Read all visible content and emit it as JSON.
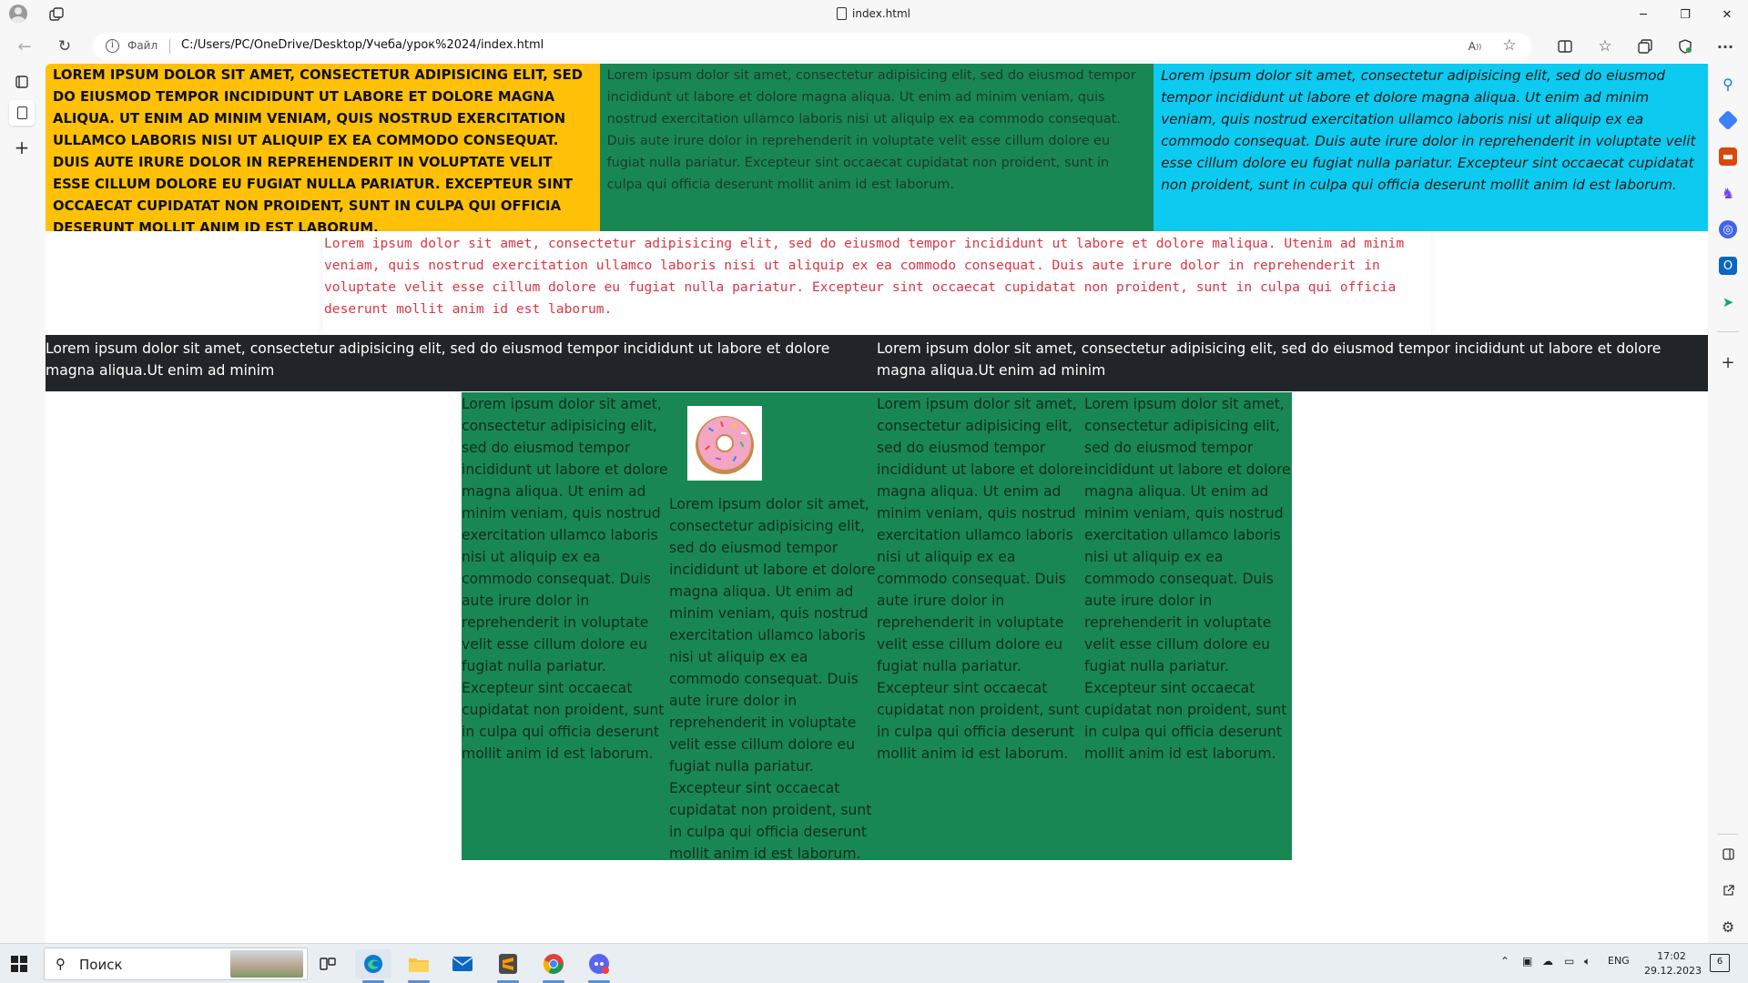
{
  "window": {
    "tab_title": "index.html",
    "minimize": "─",
    "restore": "❐",
    "close": "✕"
  },
  "address_bar": {
    "scheme_label": "Файл",
    "url": "C:/Users/PC/OneDrive/Desktop/Учеба/урок%2024/index.html"
  },
  "page": {
    "row1": {
      "yellow": "Lorem ipsum dolor sit amet, consectetur adipisicing elit, sed do eiusmod tempor incididunt ut labore et dolore magna aliqua. Ut enim ad minim veniam, quis nostrud exercitation ullamco laboris nisi ut aliquip ex ea commodo consequat. Duis aute irure dolor in reprehenderit in voluptate velit esse cillum dolore eu fugiat nulla pariatur. Excepteur sint occaecat cupidatat non proident, sunt in culpa qui officia deserunt mollit anim id est laborum.",
      "green": "Lorem ipsum dolor sit amet, consectetur adipisicing elit, sed do eiusmod tempor incididunt ut labore et dolore magna aliqua. Ut enim ad minim veniam, quis nostrud exercitation ullamco laboris nisi ut aliquip ex ea commodo consequat. Duis aute irure dolor in reprehenderit in voluptate velit esse cillum dolore eu fugiat nulla pariatur. Excepteur sint occaecat cupidatat non proident, sunt in culpa qui officia deserunt mollit anim id est laborum.",
      "cyan": "Lorem ipsum dolor sit amet, consectetur adipisicing elit, sed do eiusmod tempor incididunt ut labore et dolore magna aliqua. Ut enim ad minim veniam, quis nostrud exercitation ullamco laboris nisi ut aliquip ex ea commodo consequat. Duis aute irure dolor in reprehenderit in voluptate velit esse cillum dolore eu fugiat nulla pariatur. Excepteur sint occaecat cupidatat non proident, sunt in culpa qui officia deserunt mollit anim id est laborum."
    },
    "row2": "Lorem ipsum dolor sit amet, consectetur adipisicing elit, sed do eiusmod tempor incididunt ut labore et dolore maliqua. Utenim ad minim veniam, quis nostrud exercitation ullamco laboris nisi ut aliquip ex ea commodo consequat. Duis aute irure dolor in reprehenderit in voluptate velit esse cillum dolore eu fugiat nulla pariatur. Excepteur sint occaecat cupidatat non proident, sunt in culpa qui officia deserunt mollit anim id est laborum.",
    "row3": {
      "left": "Lorem ipsum dolor sit amet, consectetur adipisicing elit, sed do eiusmod tempor incididunt ut labore et dolore magna aliqua.Ut enim ad minim",
      "right": "Lorem ipsum dolor sit amet, consectetur adipisicing elit, sed do eiusmod tempor incididunt ut labore et dolore magna aliqua.Ut enim ad minim"
    },
    "row4": {
      "col1": "Lorem ipsum dolor sit amet, consectetur adipisicing elit, sed do eiusmod tempor incididunt ut labore et dolore magna aliqua. Ut enim ad minim veniam, quis nostrud exercitation ullamco laboris nisi ut aliquip ex ea commodo consequat. Duis aute irure dolor in reprehenderit in voluptate velit esse cillum dolore eu fugiat nulla pariatur. Excepteur sint occaecat cupidatat non proident, sunt in culpa qui officia deserunt mollit anim id est laborum.",
      "col2": "Lorem ipsum dolor sit amet, consectetur adipisicing elit, sed do eiusmod tempor incididunt ut labore et dolore magna aliqua. Ut enim ad minim veniam, quis nostrud exercitation ullamco laboris nisi ut aliquip ex ea commodo consequat. Duis aute irure dolor in reprehenderit in voluptate velit esse cillum dolore eu fugiat nulla pariatur. Excepteur sint occaecat cupidatat non proident, sunt in culpa qui officia deserunt mollit anim id est laborum.",
      "col3": "Lorem ipsum dolor sit amet, consectetur adipisicing elit, sed do eiusmod tempor incididunt ut labore et dolore magna aliqua. Ut enim ad minim veniam, quis nostrud exercitation ullamco laboris nisi ut aliquip ex ea commodo consequat. Duis aute irure dolor in reprehenderit in voluptate velit esse cillum dolore eu fugiat nulla pariatur. Excepteur sint occaecat cupidatat non proident, sunt in culpa qui officia deserunt mollit anim id est laborum.",
      "col4": "Lorem ipsum dolor sit amet, consectetur adipisicing elit, sed do eiusmod tempor incididunt ut labore et dolore magna aliqua. Ut enim ad minim veniam, quis nostrud exercitation ullamco laboris nisi ut aliquip ex ea commodo consequat. Duis aute irure dolor in reprehenderit in voluptate velit esse cillum dolore eu fugiat nulla pariatur. Excepteur sint occaecat cupidatat non proident, sunt in culpa qui officia deserunt mollit anim id est laborum."
    },
    "colors": {
      "yellow": "#ffc107",
      "green": "#198754",
      "cyan": "#0dcaf0",
      "dark": "#212529",
      "red_text": "#dc3545"
    }
  },
  "taskbar": {
    "search_placeholder": "Поиск",
    "language": "ENG",
    "time": "17:02",
    "date": "29.12.2023",
    "notification_count": "6"
  }
}
